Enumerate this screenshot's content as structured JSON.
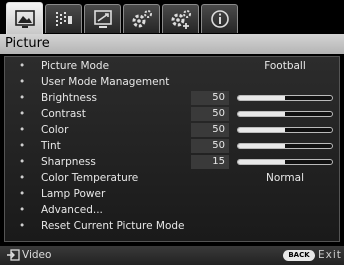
{
  "tabs": [
    {
      "icon": "picture-icon",
      "active": true
    },
    {
      "icon": "audio-settings-icon",
      "active": false
    },
    {
      "icon": "display-icon",
      "active": false
    },
    {
      "icon": "system-setup-icon",
      "active": false
    },
    {
      "icon": "advanced-setup-icon",
      "active": false
    },
    {
      "icon": "info-icon",
      "active": false
    }
  ],
  "title": "Picture",
  "items": [
    {
      "label": "Picture Mode",
      "value": "Football"
    },
    {
      "label": "User Mode Management"
    },
    {
      "label": "Brightness",
      "num": "50",
      "level": 0.5
    },
    {
      "label": "Contrast",
      "num": "50",
      "level": 0.5
    },
    {
      "label": "Color",
      "num": "50",
      "level": 0.5
    },
    {
      "label": "Tint",
      "num": "50",
      "level": 0.5
    },
    {
      "label": "Sharpness",
      "num": "15",
      "level": 0.5
    },
    {
      "label": "Color Temperature",
      "value": "Normal"
    },
    {
      "label": "Lamp Power"
    },
    {
      "label": "Advanced..."
    },
    {
      "label": "Reset Current Picture Mode"
    }
  ],
  "footer": {
    "back_target": "Video",
    "back_badge": "BACK",
    "exit_label": "Exit"
  },
  "colors": {
    "title_bg": "#c8c8c8",
    "menu_bg": "#222222",
    "active_tab": "#e6e6e6"
  }
}
